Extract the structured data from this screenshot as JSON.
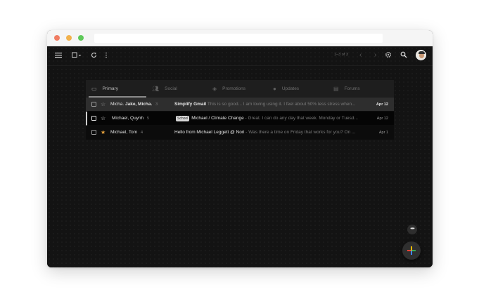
{
  "toolbar": {
    "pager_text": "1–3 of 3",
    "icons": [
      "menu-icon",
      "select-checkbox-icon",
      "refresh-icon",
      "more-vert-icon",
      "chevron-left-icon",
      "chevron-right-icon",
      "settings-icon",
      "search-icon"
    ]
  },
  "tabs": [
    {
      "label": "Primary",
      "icon": "inbox-icon",
      "active": true
    },
    {
      "label": "Social",
      "icon": "people-icon",
      "active": false
    },
    {
      "label": "Promotions",
      "icon": "tag-icon",
      "active": false
    },
    {
      "label": "Updates",
      "icon": "info-icon",
      "active": false
    },
    {
      "label": "Forums",
      "icon": "forum-icon",
      "active": false
    }
  ],
  "emails": [
    {
      "sender_a": "Micha.",
      "sender_b": "Jake, Micha.",
      "count": "3",
      "badge": "",
      "subject": "Simplify Gmail",
      "snippet": " This is so good... I am loving using it. I feel about 50% less stress when...",
      "date": "Apr 12",
      "unread": true,
      "starred": false
    },
    {
      "sender_a": "Michael, Quynh",
      "sender_b": "",
      "count": "5",
      "badge": "School",
      "subject": "Michael / Climate Change",
      "snippet": " - Great. I can do any day that week. Monday or Tuesd...",
      "date": "Apr 12",
      "unread": false,
      "starred": false
    },
    {
      "sender_a": "Michael, Tom",
      "sender_b": "",
      "count": "4",
      "badge": "",
      "subject": "Hello from Michael Leggett @ Nori",
      "snippet": " - Was there a time on Friday that works for you? On ...",
      "date": "Apr 1",
      "unread": false,
      "starred": true
    }
  ],
  "colors": {
    "traffic_red": "#f07d63",
    "traffic_yellow": "#f2b24d",
    "traffic_green": "#5fc95a",
    "star_gold": "#e8a33d",
    "plus_red": "#ea4335",
    "plus_yellow": "#fbbc04",
    "plus_green": "#34a853",
    "plus_blue": "#4285f4"
  }
}
